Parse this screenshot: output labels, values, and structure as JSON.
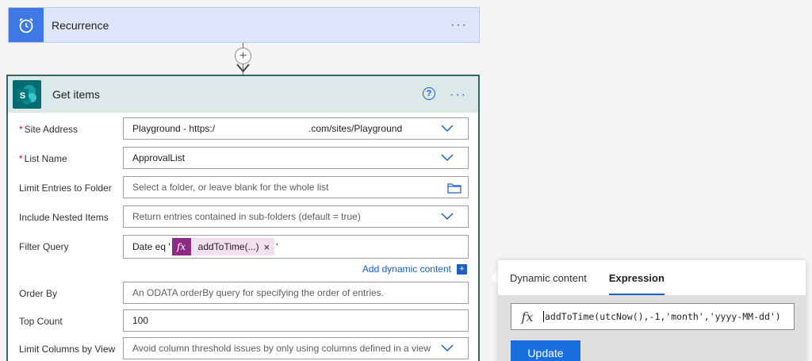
{
  "recurrence": {
    "title": "Recurrence",
    "more": "···"
  },
  "connector": {
    "plus": "+"
  },
  "get_items": {
    "title": "Get items",
    "help": "?",
    "more": "···",
    "icon_letter": "S",
    "fields": [
      {
        "label": "Site Address",
        "required": "*",
        "value": "Playground - https:/",
        "value_suffix": ".com/sites/Playground",
        "kind": "dropdown"
      },
      {
        "label": "List Name",
        "required": "*",
        "value": "ApprovalList",
        "kind": "dropdown"
      },
      {
        "label": "Limit Entries to Folder",
        "placeholder": "Select a folder, or leave blank for the whole list",
        "kind": "folder"
      },
      {
        "label": "Include Nested Items",
        "placeholder": "Return entries contained in sub-folders (default = true)",
        "kind": "dropdown"
      },
      {
        "label": "Filter Query",
        "prefix": "Date eq '",
        "token_label": "addToTime(...)",
        "token_close": "×",
        "suffix": "'",
        "kind": "token"
      },
      {
        "label": "Order By",
        "placeholder": "An ODATA orderBy query for specifying the order of entries.",
        "kind": "text"
      },
      {
        "label": "Top Count",
        "value": "100",
        "kind": "text"
      },
      {
        "label": "Limit Columns by View",
        "placeholder": "Avoid column threshold issues by only using columns defined in a view",
        "kind": "dropdown"
      }
    ],
    "add_dynamic": "Add dynamic content",
    "add_box": "+"
  },
  "expression_panel": {
    "tabs": [
      {
        "label": "Dynamic content"
      },
      {
        "label": "Expression"
      }
    ],
    "fx": "fx",
    "expression": "addToTime(utcNow(),-1,'month','yyyy-MM-dd')",
    "update_label": "Update"
  },
  "colors": {
    "accent": "#1a5ec6",
    "recurrence_bg": "#dfe6fb",
    "sharepoint": "#036c70",
    "token": "#8e2a86"
  }
}
